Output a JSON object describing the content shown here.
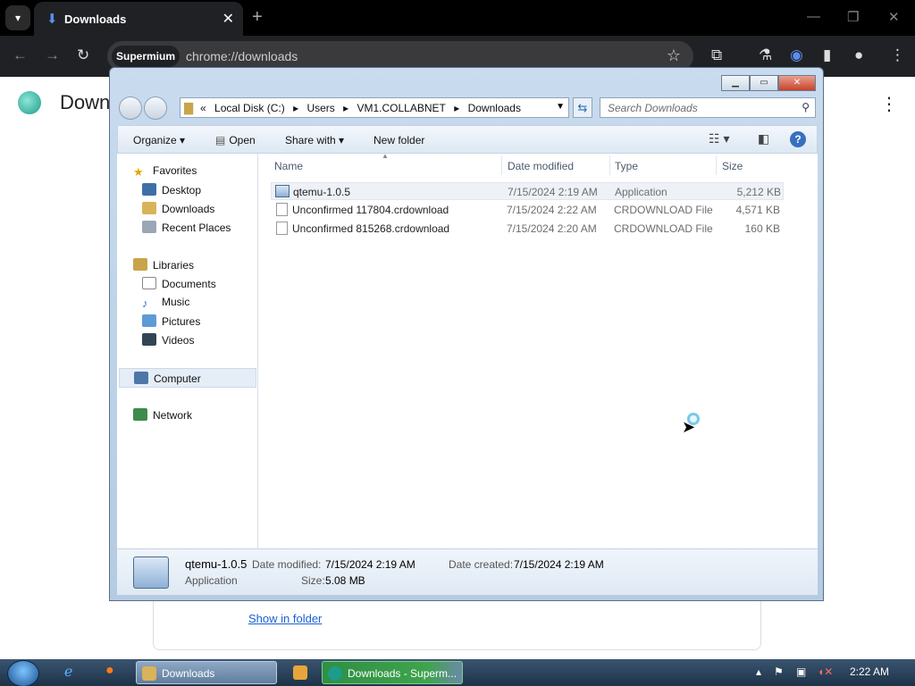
{
  "browser": {
    "tab_title": "Downloads",
    "brand": "Supermium",
    "url": "chrome://downloads"
  },
  "page": {
    "title_partial": "Down",
    "show_in_folder": "Show in folder"
  },
  "explorer": {
    "breadcrumb": [
      "Local Disk (C:)",
      "Users",
      "VM1.COLLABNET",
      "Downloads"
    ],
    "search_placeholder": "Search Downloads",
    "toolbar": {
      "organize": "Organize",
      "open": "Open",
      "share_with": "Share with",
      "new_folder": "New folder"
    },
    "nav": {
      "favorites": "Favorites",
      "desktop": "Desktop",
      "downloads": "Downloads",
      "recent_places": "Recent Places",
      "libraries": "Libraries",
      "documents": "Documents",
      "music": "Music",
      "pictures": "Pictures",
      "videos": "Videos",
      "computer": "Computer",
      "network": "Network"
    },
    "columns": [
      "Name",
      "Date modified",
      "Type",
      "Size"
    ],
    "files": [
      {
        "name": "qtemu-1.0.5",
        "date": "7/15/2024 2:19 AM",
        "type": "Application",
        "size": "5,212 KB"
      },
      {
        "name": "Unconfirmed 117804.crdownload",
        "date": "7/15/2024 2:22 AM",
        "type": "CRDOWNLOAD File",
        "size": "4,571 KB"
      },
      {
        "name": "Unconfirmed 815268.crdownload",
        "date": "7/15/2024 2:20 AM",
        "type": "CRDOWNLOAD File",
        "size": "160 KB"
      }
    ],
    "details": {
      "name": "qtemu-1.0.5",
      "type": "Application",
      "date_modified_label": "Date modified:",
      "date_modified": "7/15/2024 2:19 AM",
      "size_label": "Size:",
      "size": "5.08 MB",
      "date_created_label": "Date created:",
      "date_created": "7/15/2024 2:19 AM"
    }
  },
  "taskbar": {
    "explorer_task": "Downloads",
    "browser_task": "Downloads - Superm...",
    "clock": "2:22 AM"
  },
  "colors": {
    "chrome_dark": "#202124",
    "explorer_frame": "#c9dbee",
    "link": "#1a5fd8",
    "task_active": "#3fa34d"
  }
}
